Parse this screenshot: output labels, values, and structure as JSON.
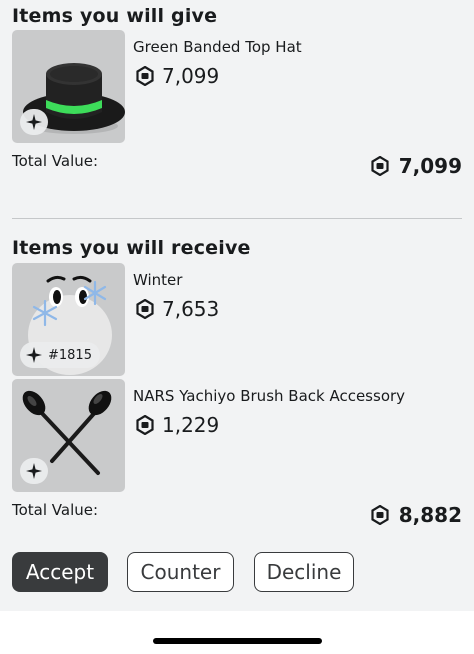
{
  "give": {
    "title": "Items you will give",
    "items": [
      {
        "name": "Green Banded Top Hat",
        "price": "7,099"
      }
    ],
    "total_label": "Total Value:",
    "total_value": "7,099"
  },
  "receive": {
    "title": "Items you will receive",
    "items": [
      {
        "name": "Winter",
        "price": "7,653",
        "serial": "#1815"
      },
      {
        "name": "NARS Yachiyo Brush Back Accessory",
        "price": "1,229"
      }
    ],
    "total_label": "Total Value:",
    "total_value": "8,882"
  },
  "actions": {
    "accept": "Accept",
    "counter": "Counter",
    "decline": "Decline"
  },
  "icons": {
    "currency": "robux-icon",
    "limited": "sparkle-icon"
  },
  "colors": {
    "background": "#f2f3f4",
    "primary_button": "#393b3d",
    "hat_band": "#3ddc5a",
    "snowflake": "#8fb8e8"
  }
}
